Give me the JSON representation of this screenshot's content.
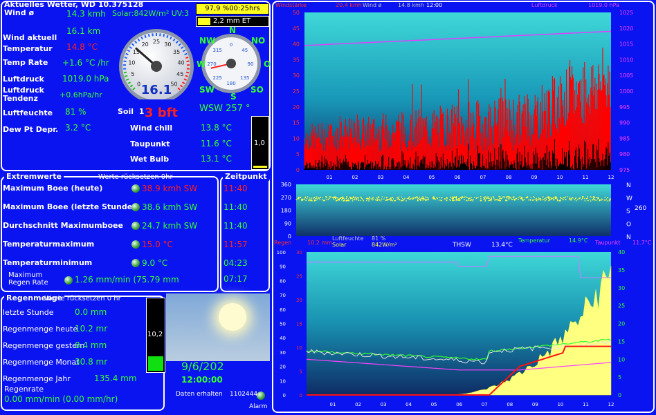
{
  "header": {
    "title": "Aktuelles Wetter, WD 10.375128",
    "badge_humidity": "97,9 %00:25hrs",
    "badge_et": "2,2 mm ET"
  },
  "current": {
    "wind_avg_label": "Wind ø",
    "wind_avg_value": "14.3 kmh",
    "solar_uv": "Solar:842W/m² UV:3",
    "wind_now_label": "Wind aktuell",
    "wind_now_value": "16.1 km",
    "temp_label": "Temperatur",
    "temp_value": "14.8 °C",
    "temprate_label": "Temp Rate",
    "temprate_value": "+1.6 °C /hr",
    "pressure_label": "Luftdruck",
    "pressure_value": "1019.0 hPa",
    "pressure_trend_label_1": "Luftdruck",
    "pressure_trend_label_2": "Tendenz",
    "pressure_trend_value": "+0.6hPa/hr",
    "humidity_label": "Luftfeuchte",
    "humidity_value": "81 %",
    "soil_label": "Soil",
    "soil_value": "1",
    "bft_value": "3 bft",
    "dewdep_label": "Dew Pt Depr.",
    "dewdep_value": "3.2 °C",
    "windchill_label": "Wind chill",
    "windchill_value": "13.8 °C",
    "taupunkt_label": "Taupunkt",
    "taupunkt_value": "11.6 °C",
    "wetbulb_label": "Wet Bulb",
    "wetbulb_value": "13.1 °C",
    "small_gauge_value": "1,0",
    "gauge_reading": "16.1",
    "wind_dir_text": "WSW  257 °"
  },
  "speed_gauge": {
    "ticks": [
      "0",
      "5",
      "10",
      "15",
      "20",
      "25",
      "30",
      "35",
      "40",
      "45",
      "50"
    ],
    "needle_fraction": 0.32
  },
  "compass": {
    "points": [
      "N",
      "NO",
      "O",
      "SO",
      "S",
      "SW",
      "W",
      "NW"
    ],
    "degrees": [
      "315",
      "0",
      "45",
      "90",
      "135",
      "180",
      "225",
      "270"
    ],
    "direction_deg": 257
  },
  "extremes": {
    "title": "Extremwerte",
    "reset_note": "Werte rücksetzen 0hr",
    "time_title": "Zeitpunkt",
    "rows": [
      {
        "label": "Maximum Boee (heute)",
        "value": "38.9 kmh  SW",
        "time": "11:40",
        "red": true
      },
      {
        "label": "Maximum Boee (letzte Stunde)",
        "value": "38.6 kmh  SW",
        "time": "11:40",
        "red": false
      },
      {
        "label": "Durchschnitt Maximumboee",
        "value": "24.7 kmh  SW",
        "time": "11:40",
        "red": false
      },
      {
        "label": "Temperaturmaximum",
        "value": "15.0 °C",
        "time": "11:57",
        "red": true
      },
      {
        "label": "Temperaturminimum",
        "value": "9.0 °C",
        "time": "04:23",
        "red": false
      }
    ],
    "rain_rate_label_1": "Maximum",
    "rain_rate_label_2": "Regen Rate",
    "rain_rate_value": "1.26 mm/min (75.79 mm",
    "rain_rate_time": "07:17"
  },
  "rain": {
    "title": "Regenmenge",
    "reset_note": "Werte rücksetzen 0 hr",
    "rows": [
      {
        "label": "letzte Stunde",
        "value": "0.0 mm"
      },
      {
        "label": "Regenmenge heute",
        "value": "10.2 mr"
      },
      {
        "label": "Regenmenge gestern",
        "value": "8.4 mm"
      },
      {
        "label": "Regenmenge Monat",
        "value": "30.8 mr"
      },
      {
        "label": "Regenmenge Jahr",
        "value": "135.4 mm"
      }
    ],
    "rate_label": "Regenrate",
    "rate_value": "0.00 mm/min (0.00 mm/hr)",
    "gauge_value": "10,2",
    "gauge_fill": 0.2
  },
  "status": {
    "date": "9/6/202",
    "time": "12:00:00",
    "data_label": "Daten erhalten",
    "data_count": "1102444",
    "alarm_label": "Alarm"
  },
  "graph_wind": {
    "legend_left": "Windstärke",
    "legend_gust": "20.4 kmh",
    "legend_avg": "Wind ø",
    "legend_avg_val": "14.8 kmh",
    "legend_time": "12:00",
    "legend_press": "Luftdruck",
    "legend_press_val": "1019.0 hPa",
    "yleft": [
      "50",
      "45",
      "40",
      "35",
      "30",
      "25",
      "20",
      "15",
      "10",
      "5",
      "0"
    ],
    "yright": [
      "1025",
      "1020",
      "1015",
      "1010",
      "1005",
      "1000",
      "995",
      "990",
      "985",
      "980",
      "975"
    ],
    "xticks": [
      "01",
      "02",
      "03",
      "04",
      "05",
      "06",
      "07",
      "08",
      "09",
      "10",
      "11",
      "12"
    ],
    "pressure_start": 1014.5,
    "pressure_end": 1019.0
  },
  "graph_dir": {
    "yleft": [
      "360",
      "270",
      "180",
      "90",
      "0"
    ],
    "right_labels": [
      "N",
      "W",
      "S",
      "O",
      "N"
    ],
    "right_value": "260",
    "mean_deg": 260
  },
  "graph_bottom": {
    "l_regen": "Regen",
    "l_regen_val": "10.2 mm",
    "l_hum": "Luftfeuchte",
    "l_hum_val": "81 %",
    "l_solar": "Solar",
    "l_solar_val": "842W/m²",
    "l_thsw": "THSW",
    "l_thsw_val": "13.4°C",
    "l_temp": "Temperatur",
    "l_temp_val": "14.9°C",
    "l_taupunkt": "Taupunkt",
    "l_taupunkt_val": "11.7°C",
    "yleft_outer": [
      "100",
      "90",
      "80",
      "70",
      "60",
      "50",
      "40",
      "30",
      "20",
      "10",
      "0"
    ],
    "yleft_inner": [
      "30",
      "25",
      "20",
      "15",
      "10",
      "5",
      "0"
    ],
    "yright": [
      "40",
      "35",
      "30",
      "25",
      "20",
      "15",
      "10",
      "5",
      "0"
    ],
    "xticks": [
      "01",
      "02",
      "03",
      "04",
      "05",
      "06",
      "07",
      "08",
      "09",
      "10",
      "11",
      "12"
    ]
  },
  "colors": {
    "bg": "#0a14f0",
    "accent_green": "#33ff33",
    "accent_red": "#ff2020",
    "pressure_line": "#e040ff",
    "dir_dots": "#ffff40"
  }
}
